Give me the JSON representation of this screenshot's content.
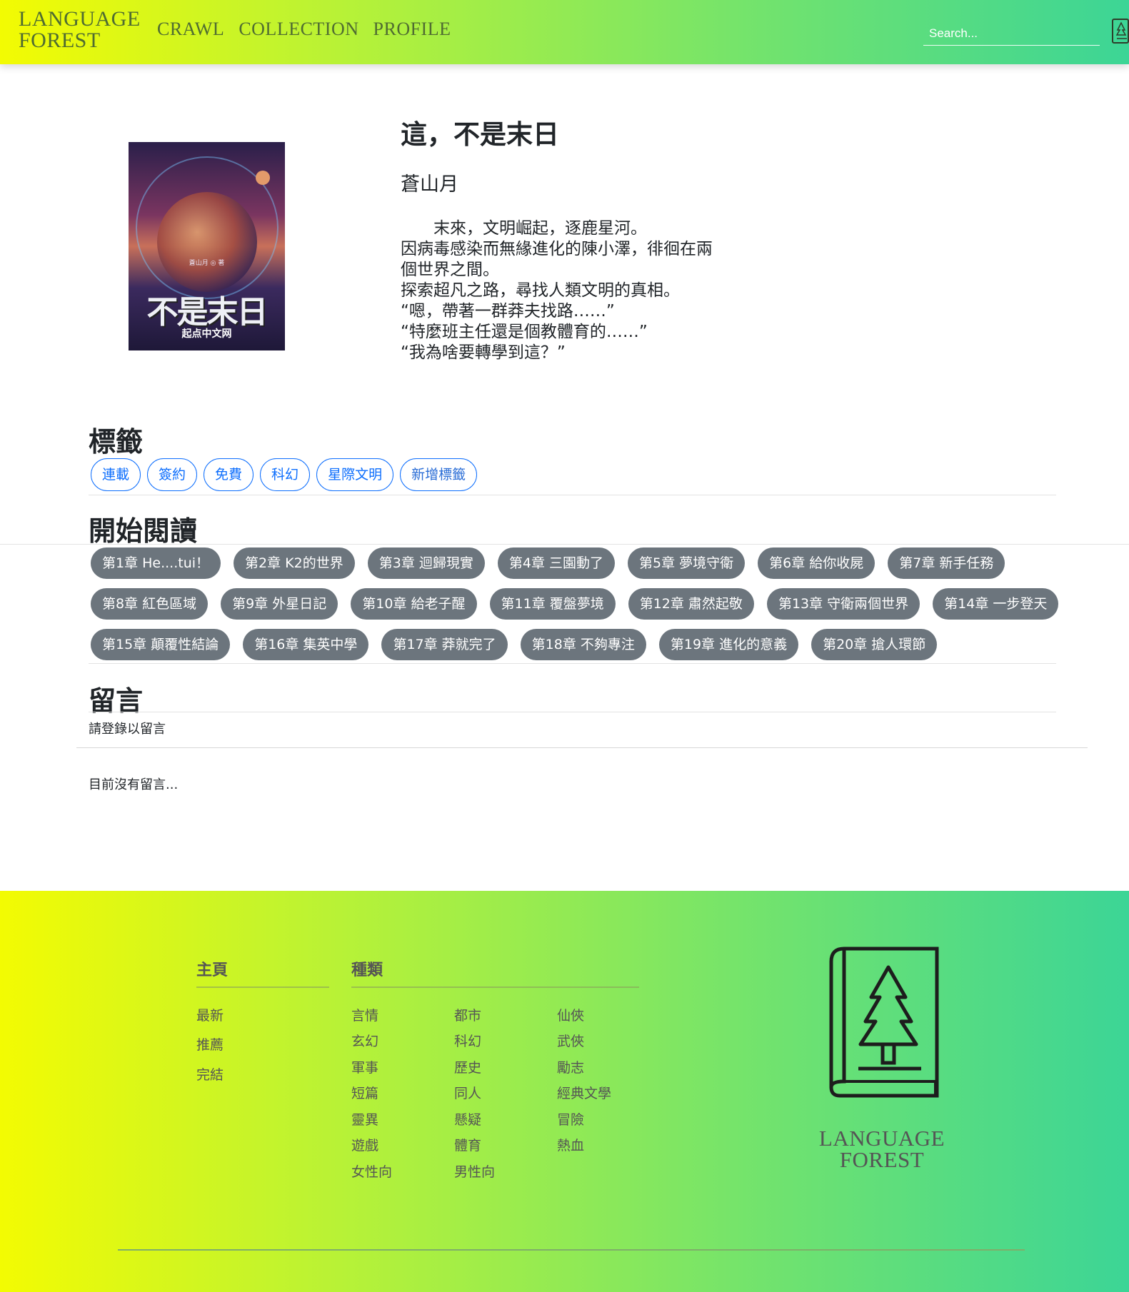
{
  "nav": {
    "brand_line1": "LANGUAGE",
    "brand_line2": "FOREST",
    "links": [
      "CRAWL",
      "COLLECTION",
      "PROFILE"
    ],
    "search_placeholder": "Search...",
    "book_icon": "book-tree-icon"
  },
  "book": {
    "cover": {
      "author_small": "蒼山月 ◎ 著",
      "title_big": "不是末日",
      "publisher": "起点中文网"
    },
    "title": "這，不是末日",
    "author": "蒼山月",
    "description": "　　末來，文明崛起，逐鹿星河。\n因病毒感染而無緣進化的陳小澤，徘徊在兩個世界之間。\n探索超凡之路，尋找人類文明的真相。\n“嗯，帶著一群莽夫找路……”\n“特麼班主任還是個教體育的……”\n“我為啥要轉學到這？”"
  },
  "tags": {
    "heading": "標籤",
    "items": [
      "連載",
      "簽約",
      "免費",
      "科幻",
      "星際文明"
    ],
    "add_label": "新增標籤"
  },
  "reading": {
    "heading": "開始閱讀",
    "rows": [
      [
        "第1章 He....tui！",
        "第2章 K2的世界",
        "第3章 迴歸現實",
        "第4章 三園動了",
        "第5章 夢境守衛",
        "第6章 給你收屍",
        "第7章 新手任務"
      ],
      [
        "第8章 紅色區域",
        "第9章 外星日記",
        "第10章 給老子醒",
        "第11章 覆盤夢境",
        "第12章 肅然起敬",
        "第13章 守衛兩個世界",
        "第14章 一步登天"
      ],
      [
        "第15章 顛覆性結論",
        "第16章 集英中學",
        "第17章 莽就完了",
        "第18章 不夠專注",
        "第19章 進化的意義",
        "第20章 搶人環節"
      ]
    ]
  },
  "comments": {
    "heading": "留言",
    "login_note": "請登錄以留言",
    "empty": "目前沒有留言..."
  },
  "footer": {
    "home_heading": "主頁",
    "home_links": [
      "最新",
      "推薦",
      "完結"
    ],
    "genre_heading": "種類",
    "genre_col1": [
      "言情",
      "玄幻",
      "軍事",
      "短篇",
      "靈異",
      "遊戲",
      "女性向"
    ],
    "genre_col2": [
      "都市",
      "科幻",
      "歷史",
      "同人",
      "懸疑",
      "體育",
      "男性向"
    ],
    "genre_col3": [
      "仙俠",
      "武俠",
      "勵志",
      "經典文學",
      "冒險",
      "熱血"
    ],
    "brand_line1": "LANGUAGE",
    "brand_line2": "FOREST"
  }
}
